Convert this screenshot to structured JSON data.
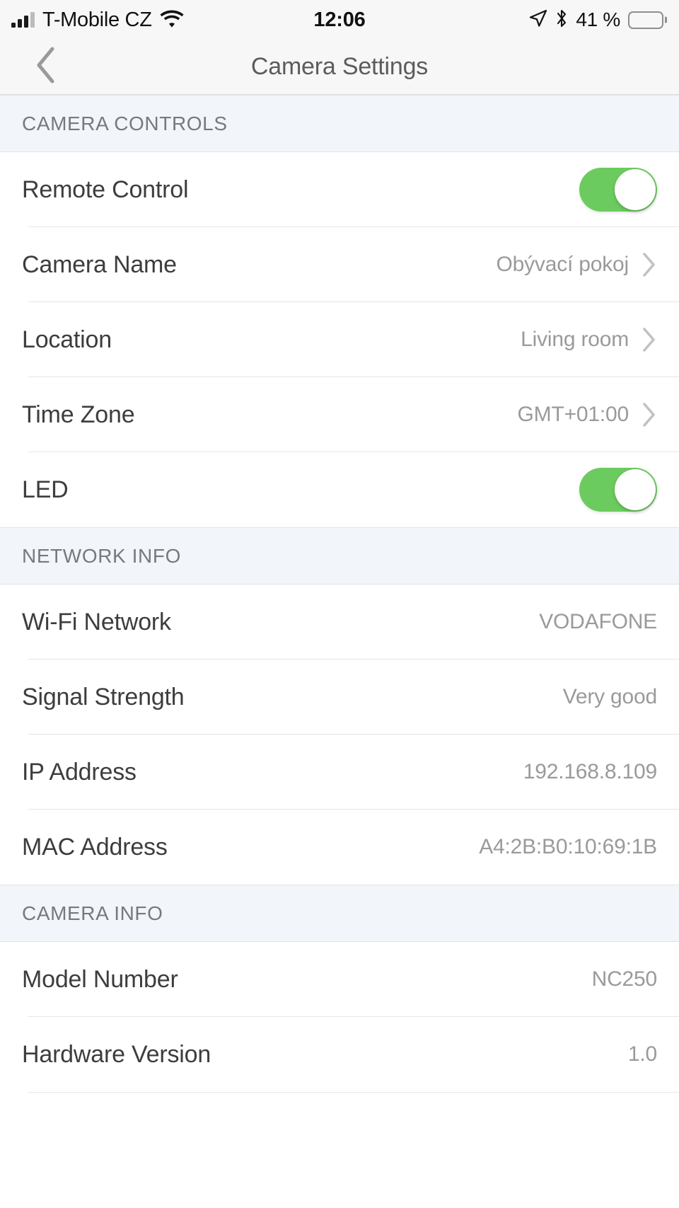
{
  "status_bar": {
    "carrier": "T-Mobile CZ",
    "time": "12:06",
    "battery_percent_label": "41 %",
    "battery_level": 41,
    "signal_bars_filled": 3,
    "signal_bars_total": 4,
    "icons": [
      "signal-bars-icon",
      "wifi-icon",
      "location-arrow-icon",
      "bluetooth-icon",
      "battery-icon"
    ]
  },
  "nav_bar": {
    "back_icon": "chevron-left-icon",
    "title": "Camera Settings"
  },
  "colors": {
    "toggle_on": "#6ccb5f",
    "section_header_bg": "#f2f5fa",
    "status_bar_bg": "#f7f7f7",
    "label_text": "#3d3d3d",
    "value_text": "#9a9a9a",
    "separator": "#e6e6e6"
  },
  "sections": [
    {
      "header": "CAMERA CONTROLS",
      "rows": [
        {
          "label": "Remote Control",
          "type": "toggle",
          "state": "on"
        },
        {
          "label": "Camera Name",
          "type": "disclosure",
          "value": "Obývací pokoj"
        },
        {
          "label": "Location",
          "type": "disclosure",
          "value": "Living room"
        },
        {
          "label": "Time Zone",
          "type": "disclosure",
          "value": "GMT+01:00"
        },
        {
          "label": "LED",
          "type": "toggle",
          "state": "on"
        }
      ]
    },
    {
      "header": "NETWORK INFO",
      "rows": [
        {
          "label": "Wi-Fi Network",
          "type": "value",
          "value": "VODAFONE"
        },
        {
          "label": "Signal Strength",
          "type": "value",
          "value": "Very good"
        },
        {
          "label": "IP Address",
          "type": "value",
          "value": "192.168.8.109"
        },
        {
          "label": "MAC Address",
          "type": "value",
          "value": "A4:2B:B0:10:69:1B"
        }
      ]
    },
    {
      "header": "CAMERA INFO",
      "rows": [
        {
          "label": "Model Number",
          "type": "value",
          "value": "NC250"
        },
        {
          "label": "Hardware Version",
          "type": "value",
          "value": "1.0"
        }
      ]
    }
  ]
}
